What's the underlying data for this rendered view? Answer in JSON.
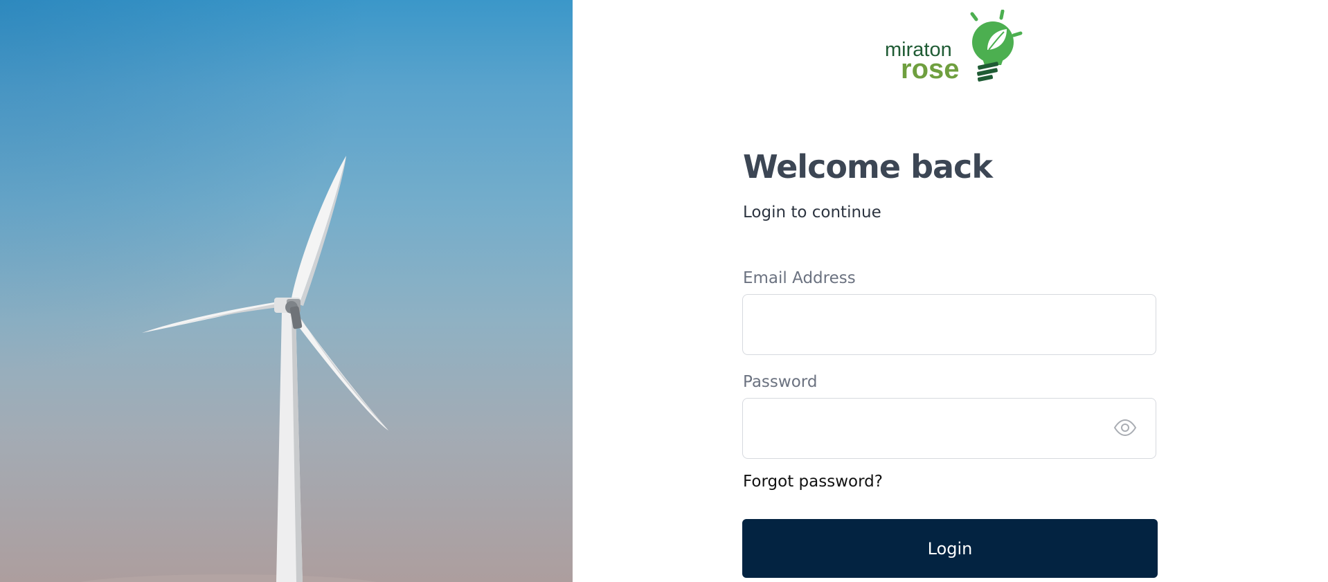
{
  "brand": {
    "name_line_1": "miraton",
    "name_line_2": "rose",
    "colors": {
      "dark_green": "#1f5b34",
      "light_green": "#6f9f3f",
      "bulb_green": "#4caf50"
    }
  },
  "hero": {
    "image": "wind-turbine-against-blue-sky"
  },
  "login": {
    "title": "Welcome back",
    "subtitle": "Login to continue",
    "email_label": "Email Address",
    "email_value": "",
    "password_label": "Password",
    "password_value": "",
    "password_toggle_icon": "eye-icon",
    "forgot_link": "Forgot password?",
    "submit_label": "Login",
    "button_color": "#032341"
  }
}
